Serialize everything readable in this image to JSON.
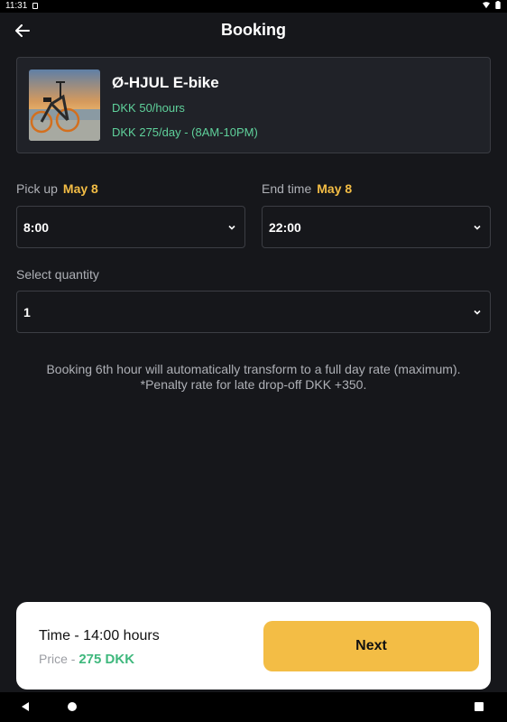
{
  "status_bar": {
    "time": "11:31",
    "icons": [
      "wifi-icon",
      "battery-icon"
    ]
  },
  "header": {
    "title": "Booking",
    "back_icon": "arrow-left-icon"
  },
  "product": {
    "name": "Ø-HJUL E-bike",
    "rate_hourly": "DKK 50/hours",
    "rate_daily": "DKK 275/day - (8AM-10PM)",
    "image": "e-bike-photo"
  },
  "pickup": {
    "label": "Pick up",
    "date": "May 8",
    "value": "8:00"
  },
  "end": {
    "label": "End time",
    "date": "May 8",
    "value": "22:00"
  },
  "quantity": {
    "label": "Select quantity",
    "value": "1"
  },
  "notice": {
    "line1": "Booking 6th hour will automatically transform to a full day rate (maximum).",
    "line2": "*Penalty rate for late drop-off DKK +350."
  },
  "footer": {
    "time_text": "Time - 14:00 hours",
    "price_label": "Price - ",
    "price_value": "275 DKK",
    "next_label": "Next"
  },
  "colors": {
    "background": "#16171b",
    "card": "#202228",
    "accent": "#f3bd45",
    "green": "#5fd19b",
    "price_green": "#3fb87d"
  }
}
